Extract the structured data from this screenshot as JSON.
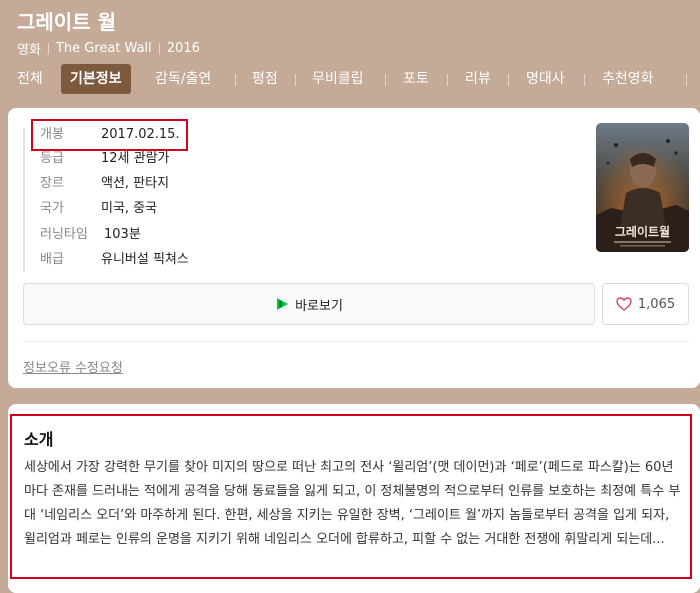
{
  "movie": {
    "title": "그레이트 월",
    "category": "영화",
    "original_title": "The Great Wall",
    "year": "2016"
  },
  "tabs": [
    {
      "label": "전체",
      "active": false
    },
    {
      "label": "기본정보",
      "active": true
    },
    {
      "label": "감독/출연",
      "active": false
    },
    {
      "label": "평점",
      "active": false
    },
    {
      "label": "무비클립",
      "active": false
    },
    {
      "label": "포토",
      "active": false
    },
    {
      "label": "리뷰",
      "active": false
    },
    {
      "label": "명대사",
      "active": false
    },
    {
      "label": "추천영화",
      "active": false
    }
  ],
  "info": [
    {
      "label": "개봉",
      "value": "2017.02.15."
    },
    {
      "label": "등급",
      "value": "12세 관람가"
    },
    {
      "label": "장르",
      "value": "액션, 판타지"
    },
    {
      "label": "국가",
      "value": "미국, 중국"
    },
    {
      "label": "러닝타임",
      "value": "103분"
    },
    {
      "label": "배급",
      "value": "유니버설 픽쳐스"
    }
  ],
  "poster": {
    "text": "그레이트월"
  },
  "actions": {
    "watch_label": "바로보기",
    "like_count": "1,065"
  },
  "edit_link": "정보오류 수정요청",
  "intro": {
    "title": "소개",
    "body": "세상에서 가장 강력한 무기를 찾아 미지의 땅으로 떠난 최고의 전사 ‘윌리엄’(맷 데이먼)과 ‘페로’(페드로 파스칼)는 60년마다 존재를 드러내는 적에게 공격을 당해 동료들을 잃게 되고, 이 정체불명의 적으로부터 인류를 보호하는 최정예 특수 부대 ‘네임리스 오더’와 마주하게 된다. 한편, 세상을 지키는 유일한 장벽, ‘그레이트 월’까지 놈들로부터 공격을 입게 되자, 윌리엄과 페로는 인류의 운명을 지키기 위해 네임리스 오더에 합류하고, 피할 수 없는 거대한 전쟁에 휘말리게 되는데..."
  },
  "colors": {
    "header_bg": "#c4aa97",
    "active_tab": "#7d5a3e",
    "highlight": "#d0021b"
  }
}
